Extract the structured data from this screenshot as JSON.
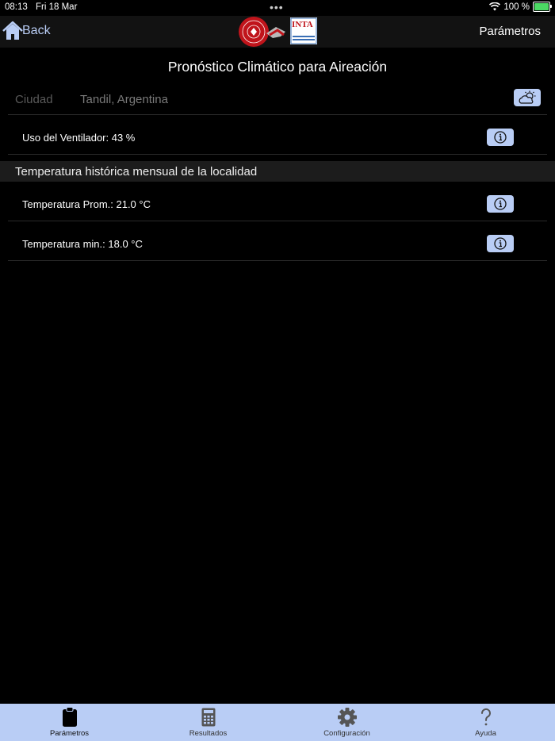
{
  "status": {
    "time": "08:13",
    "date": "Fri 18 Mar",
    "battery": "100 %"
  },
  "nav": {
    "back_label": "Back",
    "right_label": "Parámetros",
    "logo_text": "INTA"
  },
  "page": {
    "title": "Pronóstico Climático para Aireación"
  },
  "city": {
    "label": "Ciudad",
    "value": "Tandil, Argentina"
  },
  "fan_usage": {
    "label": "Uso del Ventilador: 43 %"
  },
  "section": {
    "title": "Temperatura histórica mensual de la localidad"
  },
  "temps": {
    "avg_label": "Temperatura Prom.: 21.0 °C",
    "min_label": "Temperatura min.: 18.0 °C"
  },
  "tabs": [
    {
      "label": "Parámetros",
      "icon": "clipboard-icon"
    },
    {
      "label": "Resultados",
      "icon": "calculator-icon"
    },
    {
      "label": "Configuración",
      "icon": "gear-icon"
    },
    {
      "label": "Ayuda",
      "icon": "question-icon"
    }
  ],
  "colors": {
    "accent": "#b9cdf5",
    "background": "#000000",
    "battery": "#4cd964"
  }
}
